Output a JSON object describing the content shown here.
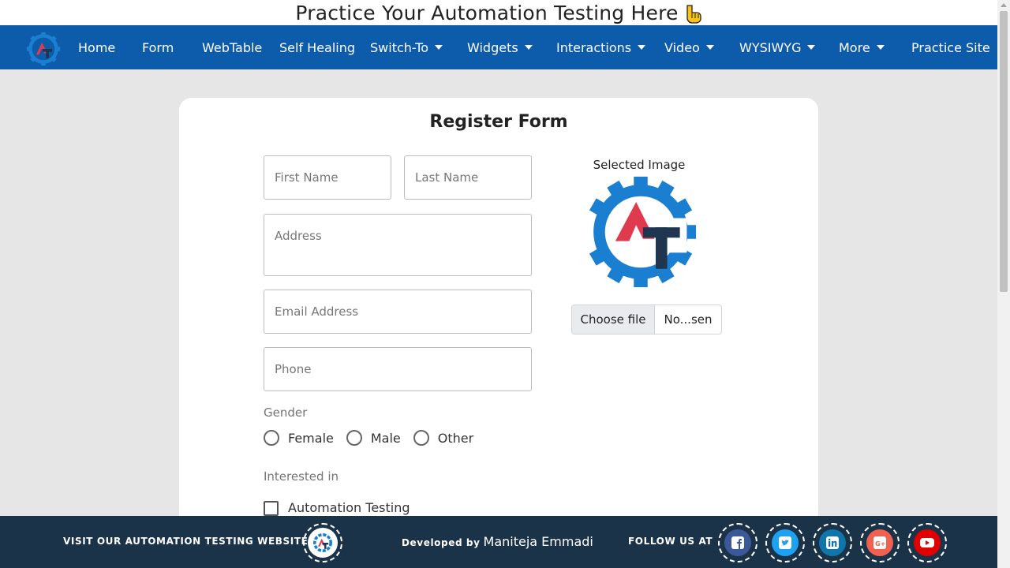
{
  "banner": {
    "title": "Practice Your Automation Testing Here"
  },
  "nav": {
    "logo": "automation-testing-logo",
    "items": [
      {
        "label": "Home",
        "dropdown": false
      },
      {
        "label": "Form",
        "dropdown": false
      },
      {
        "label": "WebTable",
        "dropdown": false
      },
      {
        "label": "Self Healing",
        "dropdown": false
      },
      {
        "label": "Switch-To",
        "dropdown": true
      },
      {
        "label": "Widgets",
        "dropdown": true
      },
      {
        "label": "Interactions",
        "dropdown": true
      },
      {
        "label": "Video",
        "dropdown": true
      },
      {
        "label": "WYSIWYG",
        "dropdown": true
      },
      {
        "label": "More",
        "dropdown": true
      },
      {
        "label": "Practice Site",
        "dropdown": false
      }
    ]
  },
  "form": {
    "title": "Register Form",
    "first_name_placeholder": "First Name",
    "last_name_placeholder": "Last Name",
    "address_placeholder": "Address",
    "email_placeholder": "Email Address",
    "phone_placeholder": "Phone",
    "gender_label": "Gender",
    "gender_options": [
      "Female",
      "Male",
      "Other"
    ],
    "interested_label": "Interested in",
    "interests": [
      "Automation Testing"
    ],
    "selected_image_label": "Selected Image",
    "file_button": "Choose file",
    "file_name": "No...sen"
  },
  "footer": {
    "visit_text": "VISIT OUR AUTOMATION TESTING WEBSITE AT",
    "developed_by": "Developed by",
    "developer": "Maniteja Emmadi",
    "follow_text": "FOLLOW US AT",
    "socials": [
      "facebook-icon",
      "twitter-icon",
      "linkedin-icon",
      "google-plus-icon",
      "youtube-icon"
    ]
  },
  "colors": {
    "nav_bg": "#0d5bab",
    "footer_bg": "#1b3349",
    "logo_blue": "#1a7fd1",
    "logo_red": "#e03a4e",
    "logo_dark": "#1f3550"
  }
}
